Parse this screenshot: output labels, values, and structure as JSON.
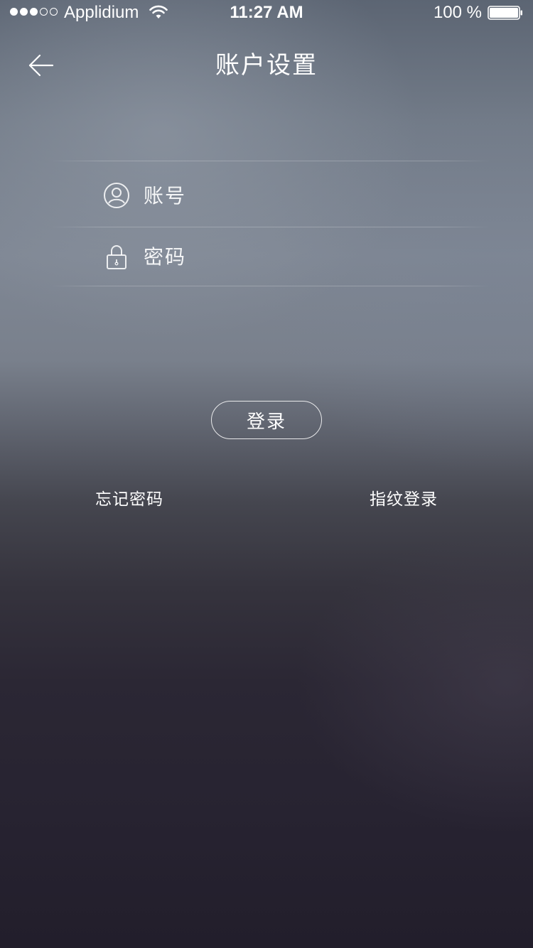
{
  "status_bar": {
    "carrier": "Applidium",
    "time": "11:27 AM",
    "battery": "100 %",
    "battery_level": 1.0,
    "signal_strength": 3,
    "signal_max": 5
  },
  "nav": {
    "title": "账户设置",
    "back_icon": "arrow-left-icon"
  },
  "form": {
    "account": {
      "placeholder": "账号",
      "value": "",
      "icon": "user-icon"
    },
    "password": {
      "placeholder": "密码",
      "value": "",
      "icon": "lock-icon"
    },
    "login_label": "登录"
  },
  "links": {
    "forgot_password": "忘记密码",
    "fingerprint_login": "指纹登录"
  },
  "colors": {
    "text": "#ffffff",
    "divider": "rgba(255,255,255,0.22)",
    "background_top": "#727b88",
    "background_bottom": "#221e2b"
  }
}
